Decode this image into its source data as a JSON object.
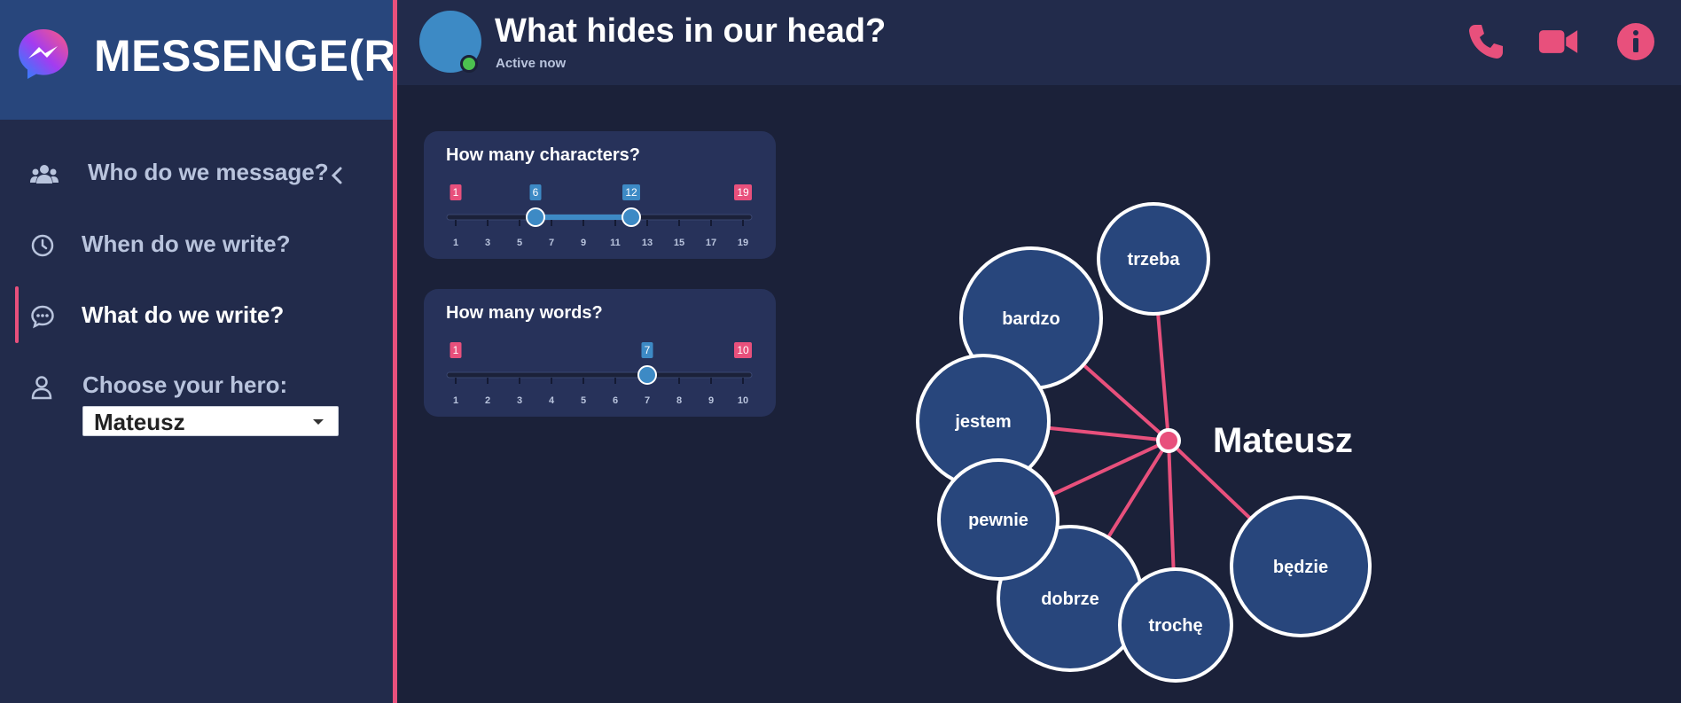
{
  "app": {
    "title": "MESSENGE(R)"
  },
  "sidebar": {
    "items": [
      {
        "label": "Who do we message?",
        "icon": "users-icon"
      },
      {
        "label": "When do we write?",
        "icon": "clock-icon"
      },
      {
        "label": "What do we write?",
        "icon": "chat-bubble-icon",
        "active": true
      },
      {
        "label": "Choose your hero:",
        "icon": "user-icon"
      }
    ],
    "hero_select": {
      "value": "Mateusz"
    }
  },
  "header": {
    "title": "What hides in our head?",
    "status": "Active now",
    "buttons": [
      "phone-icon",
      "video-icon",
      "info-icon"
    ]
  },
  "filters": {
    "characters": {
      "title": "How many characters?",
      "min": 1,
      "max": 19,
      "low": 6,
      "high": 12,
      "ticks": [
        "1",
        "3",
        "5",
        "7",
        "9",
        "11",
        "13",
        "15",
        "17",
        "19"
      ]
    },
    "words": {
      "title": "How many words?",
      "min": 1,
      "max": 10,
      "value": 7,
      "ticks": [
        "1",
        "2",
        "3",
        "4",
        "5",
        "6",
        "7",
        "8",
        "9",
        "10"
      ]
    }
  },
  "graph": {
    "center": "Mateusz",
    "words": [
      "trzeba",
      "bardzo",
      "jestem",
      "pewnie",
      "dobrze",
      "trochę",
      "będzie"
    ]
  },
  "colors": {
    "accent": "#e8507c",
    "slider": "#3d8ac5",
    "node_fill": "#28467c",
    "background": "#1b2139"
  }
}
